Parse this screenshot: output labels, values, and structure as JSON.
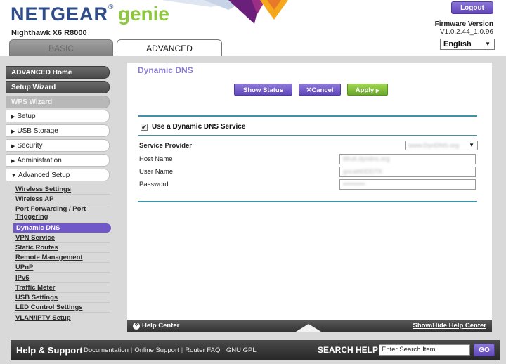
{
  "header": {
    "brand_netgear": "NETGEAR",
    "brand_reg": "®",
    "brand_genie": "genie",
    "model": "Nighthawk X6 R8000",
    "logout_label": "Logout",
    "firmware_label": "Firmware Version",
    "firmware_value": "V1.0.2.44_1.0.96",
    "language": "English"
  },
  "tabs": {
    "basic": "BASIC",
    "advanced": "ADVANCED"
  },
  "sidebar": {
    "advanced_home": "ADVANCED Home",
    "setup_wizard": "Setup Wizard",
    "wps_wizard": "WPS Wizard",
    "sections": [
      "Setup",
      "USB Storage",
      "Security",
      "Administration",
      "Advanced Setup"
    ],
    "advanced_setup_items": [
      "Wireless Settings",
      "Wireless AP",
      "Port Forwarding / Port Triggering",
      "Dynamic DNS",
      "VPN Service",
      "Static Routes",
      "Remote Management",
      "UPnP",
      "IPv6",
      "Traffic Meter",
      "USB Settings",
      "LED Control Settings",
      "VLAN/IPTV Setup"
    ],
    "active_item": "Dynamic DNS"
  },
  "main": {
    "title": "Dynamic DNS",
    "show_status": "Show Status",
    "cancel": "Cancel",
    "apply": "Apply",
    "use_ddns_label": "Use a Dynamic DNS Service",
    "use_ddns_checked": true,
    "service_provider_label": "Service Provider",
    "service_provider_value": "www.DynDNS.org",
    "host_name_label": "Host Name",
    "host_name_value": "tifruit.dyndns.org",
    "user_name_label": "User Name",
    "user_name_value": "gocattt0DDTK",
    "password_label": "Password",
    "password_value": "••••••••••"
  },
  "help_bar": {
    "label": "Help Center",
    "toggle": "Show/Hide Help Center"
  },
  "footer": {
    "title": "Help & Support",
    "links": [
      "Documentation",
      "Online Support",
      "Router FAQ",
      "GNU GPL"
    ],
    "search_label": "SEARCH HELP",
    "search_placeholder": "Enter Search Item",
    "go_label": "GO"
  },
  "colors": {
    "accent_purple": "#6148bb",
    "apply_green": "#6aa82c",
    "brand_blue": "#2f4d8a",
    "genie_green": "#8dc63f",
    "rule_teal": "#3d93a8"
  }
}
